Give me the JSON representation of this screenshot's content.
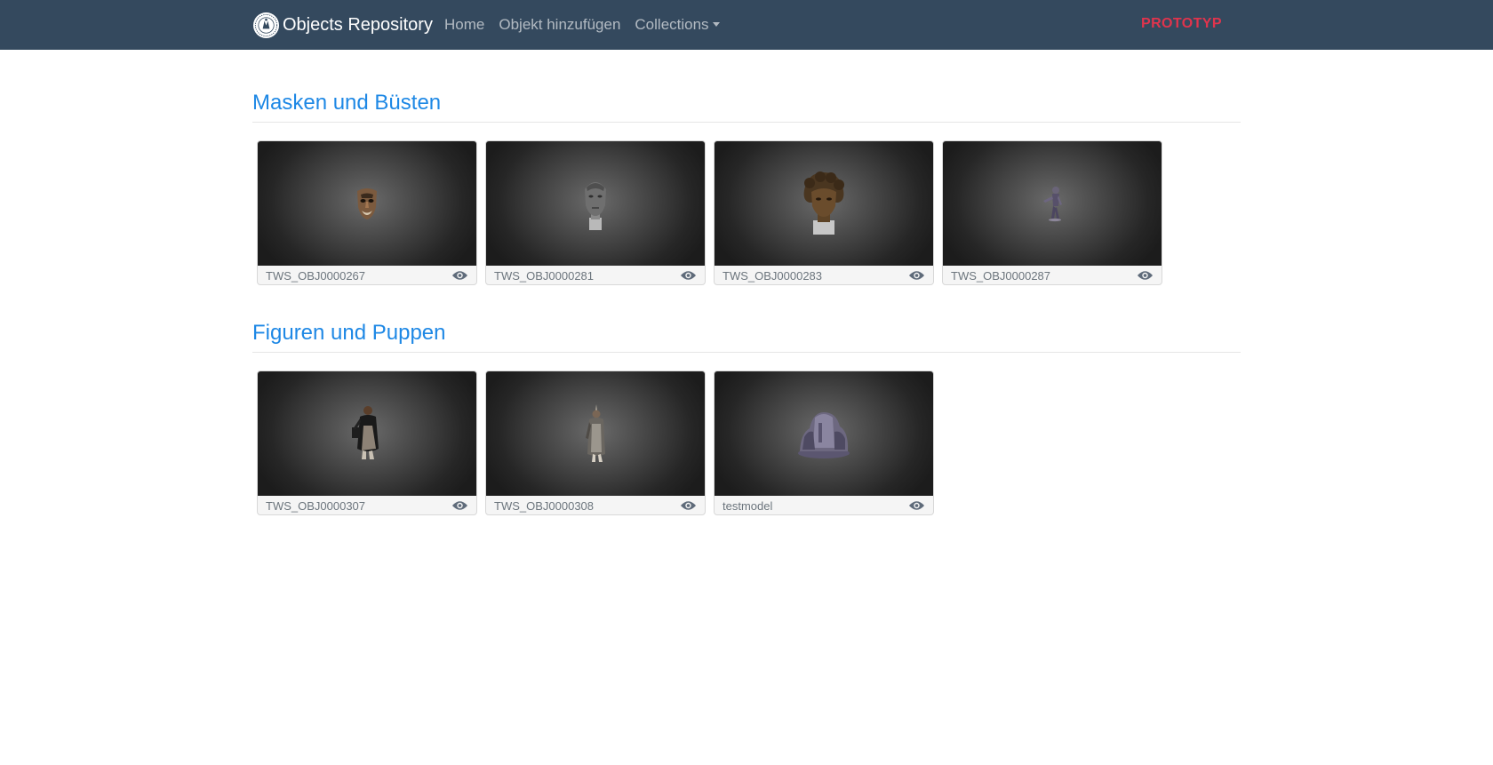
{
  "navbar": {
    "brand": "Objects Repository",
    "links": [
      {
        "label": "Home"
      },
      {
        "label": "Objekt hinzufügen"
      },
      {
        "label": "Collections"
      }
    ],
    "badge": "PROTOTYP",
    "badge_color": "#e0344d",
    "background": "#34495e"
  },
  "sections": [
    {
      "title": "Masken und Büsten",
      "items": [
        {
          "label": "TWS_OBJ0000267",
          "icon": "eye-icon"
        },
        {
          "label": "TWS_OBJ0000281",
          "icon": "eye-icon"
        },
        {
          "label": "TWS_OBJ0000283",
          "icon": "eye-icon"
        },
        {
          "label": "TWS_OBJ0000287",
          "icon": "eye-icon"
        }
      ]
    },
    {
      "title": "Figuren und Puppen",
      "items": [
        {
          "label": "TWS_OBJ0000307",
          "icon": "eye-icon"
        },
        {
          "label": "TWS_OBJ0000308",
          "icon": "eye-icon"
        },
        {
          "label": "testmodel",
          "icon": "eye-icon"
        }
      ]
    }
  ],
  "accent_color": "#1e88e5"
}
